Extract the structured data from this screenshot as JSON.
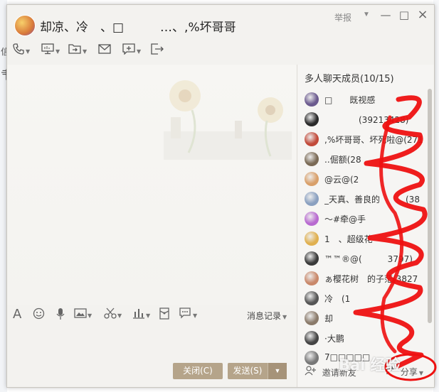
{
  "window": {
    "title": "却凉、冷　、□　　　…、,%坏哥哥",
    "report_label": "举报",
    "controls": {
      "minimize": "—",
      "maximize": "□",
      "close": "×"
    }
  },
  "background_app": {
    "fragments": [
      "信",
      "肀"
    ]
  },
  "toolbar": {
    "icons": [
      "phone-icon",
      "screen-share-icon",
      "file-transfer-icon",
      "mail-icon",
      "add-app-icon",
      "exit-icon"
    ]
  },
  "input_toolbar": {
    "icons": [
      "font-icon",
      "emoji-icon",
      "voice-icon",
      "image-icon",
      "screenshot-icon",
      "chart-icon",
      "red-packet-icon",
      "more-icon"
    ],
    "history_label": "消息记录"
  },
  "buttons": {
    "close_label": "关闭(C)",
    "send_label": "发送(S)"
  },
  "members_panel": {
    "title": "多人聊天成员(10/15)",
    "members": [
      {
        "name": "□　　既视感",
        "avatar_color": "#6b5a8e"
      },
      {
        "name": "　　　　(39213428)",
        "avatar_color": "#2a2a2a"
      },
      {
        "name": ",%坏哥哥、坏死啦@(2711",
        "avatar_color": "#c24a3a"
      },
      {
        "name": "..倔额(28",
        "avatar_color": "#7a6a55"
      },
      {
        "name": "@云@(2",
        "avatar_color": "#d9a06a"
      },
      {
        "name": "_天真、善良的　　　(38",
        "avatar_color": "#8aa0c0"
      },
      {
        "name": "～#牵@手",
        "avatar_color": "#b86ad0"
      },
      {
        "name": "1　、超级花",
        "avatar_color": "#e0b050"
      },
      {
        "name": "™™®@(　　　3797)",
        "avatar_color": "#3a3a3a"
      },
      {
        "name": "ぁ樱花树　的子茫(3827",
        "avatar_color": "#c9886a"
      },
      {
        "name": "冷　(1",
        "avatar_color": "#555555"
      },
      {
        "name": "却",
        "avatar_color": "#8a7a6a"
      },
      {
        "name": "·大鹏",
        "avatar_color": "#444444"
      },
      {
        "name": "7□□□□□",
        "avatar_color": "#777777"
      }
    ],
    "invite_label": "邀请新友",
    "share_label": "分享"
  },
  "watermark_text": "Bai 经验",
  "colors": {
    "accent_button": "#b5a48a",
    "scribble": "#ee1111",
    "window_bg": "#f3f2ef",
    "panel_bg": "#f6f5f3"
  }
}
